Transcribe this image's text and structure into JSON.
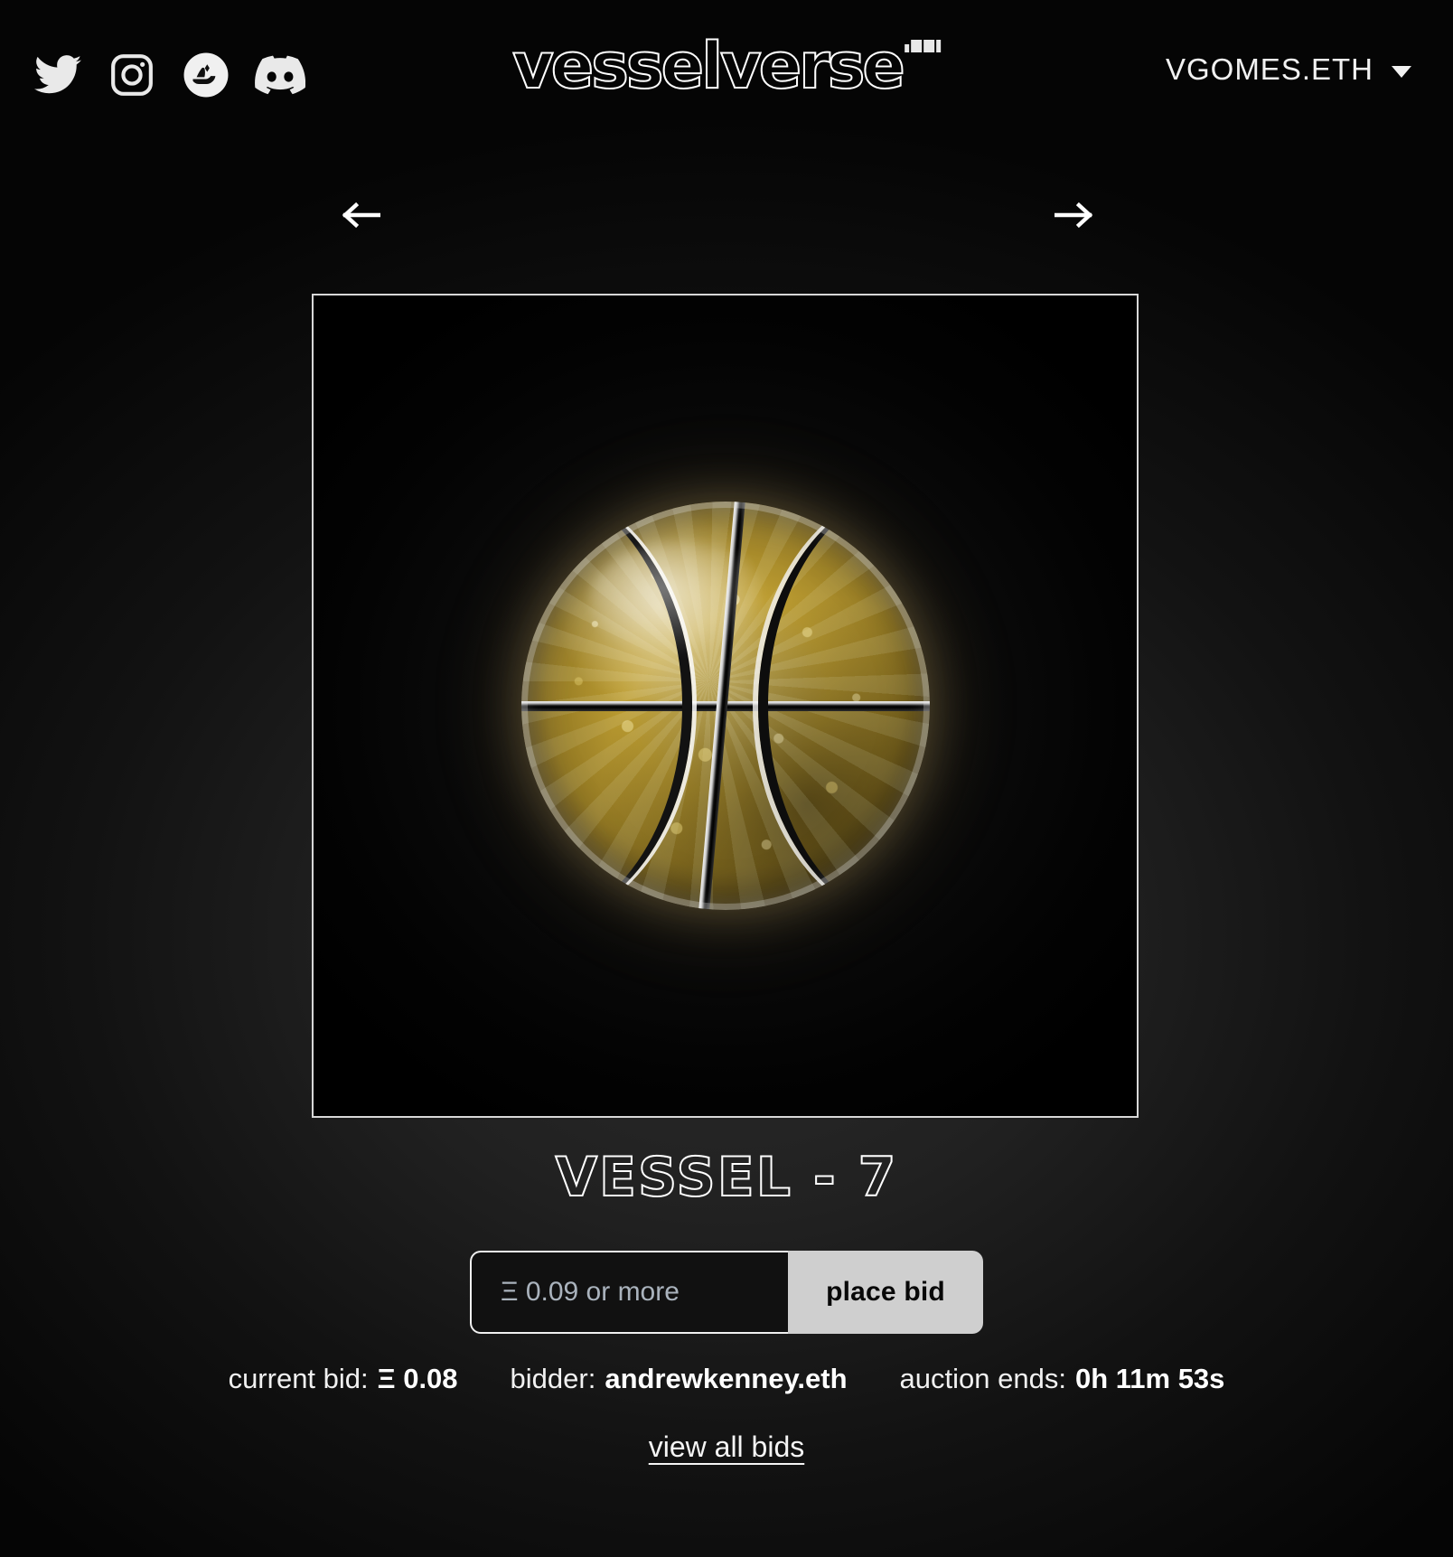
{
  "header": {
    "social_links": [
      {
        "name": "twitter",
        "icon": "twitter-icon",
        "label": "Twitter"
      },
      {
        "name": "instagram",
        "icon": "instagram-icon",
        "label": "Instagram"
      },
      {
        "name": "opensea",
        "icon": "opensea-icon",
        "label": "OpenSea"
      },
      {
        "name": "discord",
        "icon": "discord-icon",
        "label": "Discord"
      }
    ],
    "brand": "vesselverse",
    "wallet": {
      "address": "VGOMES.ETH",
      "caret_icon": "chevron-down-icon"
    }
  },
  "gallery": {
    "prev_icon": "arrow-left-icon",
    "next_icon": "arrow-right-icon",
    "artwork_alt": "glass basketball filled with gold crystal fragments"
  },
  "piece": {
    "title": "VESSEL - 7"
  },
  "bid_form": {
    "placeholder": "Ξ 0.09 or more",
    "value": "",
    "submit_label": "place bid"
  },
  "auction": {
    "current_bid_label": "current bid:",
    "current_bid_value": "Ξ 0.08",
    "bidder_label": "bidder:",
    "bidder_value": "andrewkenney.eth",
    "ends_label": "auction ends:",
    "ends_value": "0h 11m 53s",
    "view_all_bids": "view all bids"
  },
  "colors": {
    "background": "#000000",
    "text": "#ffffff",
    "button_bg": "#cfcfcf",
    "button_text": "#080808",
    "placeholder": "#aab3bd",
    "frame_border": "#d8d8d8",
    "gold": "#b8982f"
  }
}
